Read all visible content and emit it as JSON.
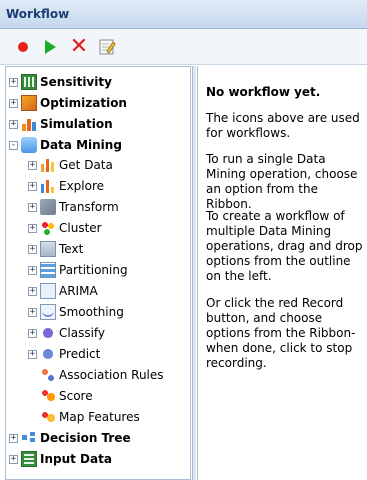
{
  "header": {
    "title": "Workflow"
  },
  "toolbar": {
    "record": "record-icon",
    "run": "play-icon",
    "clear": "delete-x-icon",
    "edit": "edit-pencil-icon",
    "colors": {
      "record": "#e8221a",
      "run": "#1faa2a",
      "clear": "#e02018"
    }
  },
  "tree": {
    "items": [
      {
        "label": "Sensitivity",
        "expander": "+",
        "bold": true
      },
      {
        "label": "Optimization",
        "expander": "+",
        "bold": true
      },
      {
        "label": "Simulation",
        "expander": "+",
        "bold": true
      },
      {
        "label": "Data Mining",
        "expander": "-",
        "bold": true
      },
      {
        "label": "Get Data",
        "expander": "+"
      },
      {
        "label": "Explore",
        "expander": "+"
      },
      {
        "label": "Transform",
        "expander": "+"
      },
      {
        "label": "Cluster",
        "expander": "+"
      },
      {
        "label": "Text",
        "expander": "+"
      },
      {
        "label": "Partitioning",
        "expander": "+"
      },
      {
        "label": "ARIMA",
        "expander": "+"
      },
      {
        "label": "Smoothing",
        "expander": "+"
      },
      {
        "label": "Classify",
        "expander": "+"
      },
      {
        "label": "Predict",
        "expander": "+"
      },
      {
        "label": "Association Rules"
      },
      {
        "label": "Score"
      },
      {
        "label": "Map Features"
      },
      {
        "label": "Decision Tree",
        "expander": "+",
        "bold": true
      },
      {
        "label": "Input Data",
        "expander": "+",
        "bold": true
      }
    ]
  },
  "description": {
    "title": "No workflow yet.",
    "p1": "The icons above are used for workflows.",
    "p2": "To run a single Data Mining operation, choose an option from the Ribbon.",
    "p3": "To create a workflow of multiple Data Mining operations, drag and drop options from the outline on the left.",
    "p4": "Or click the red Record button, and choose options from the Ribbon- when done, click to stop recording."
  }
}
